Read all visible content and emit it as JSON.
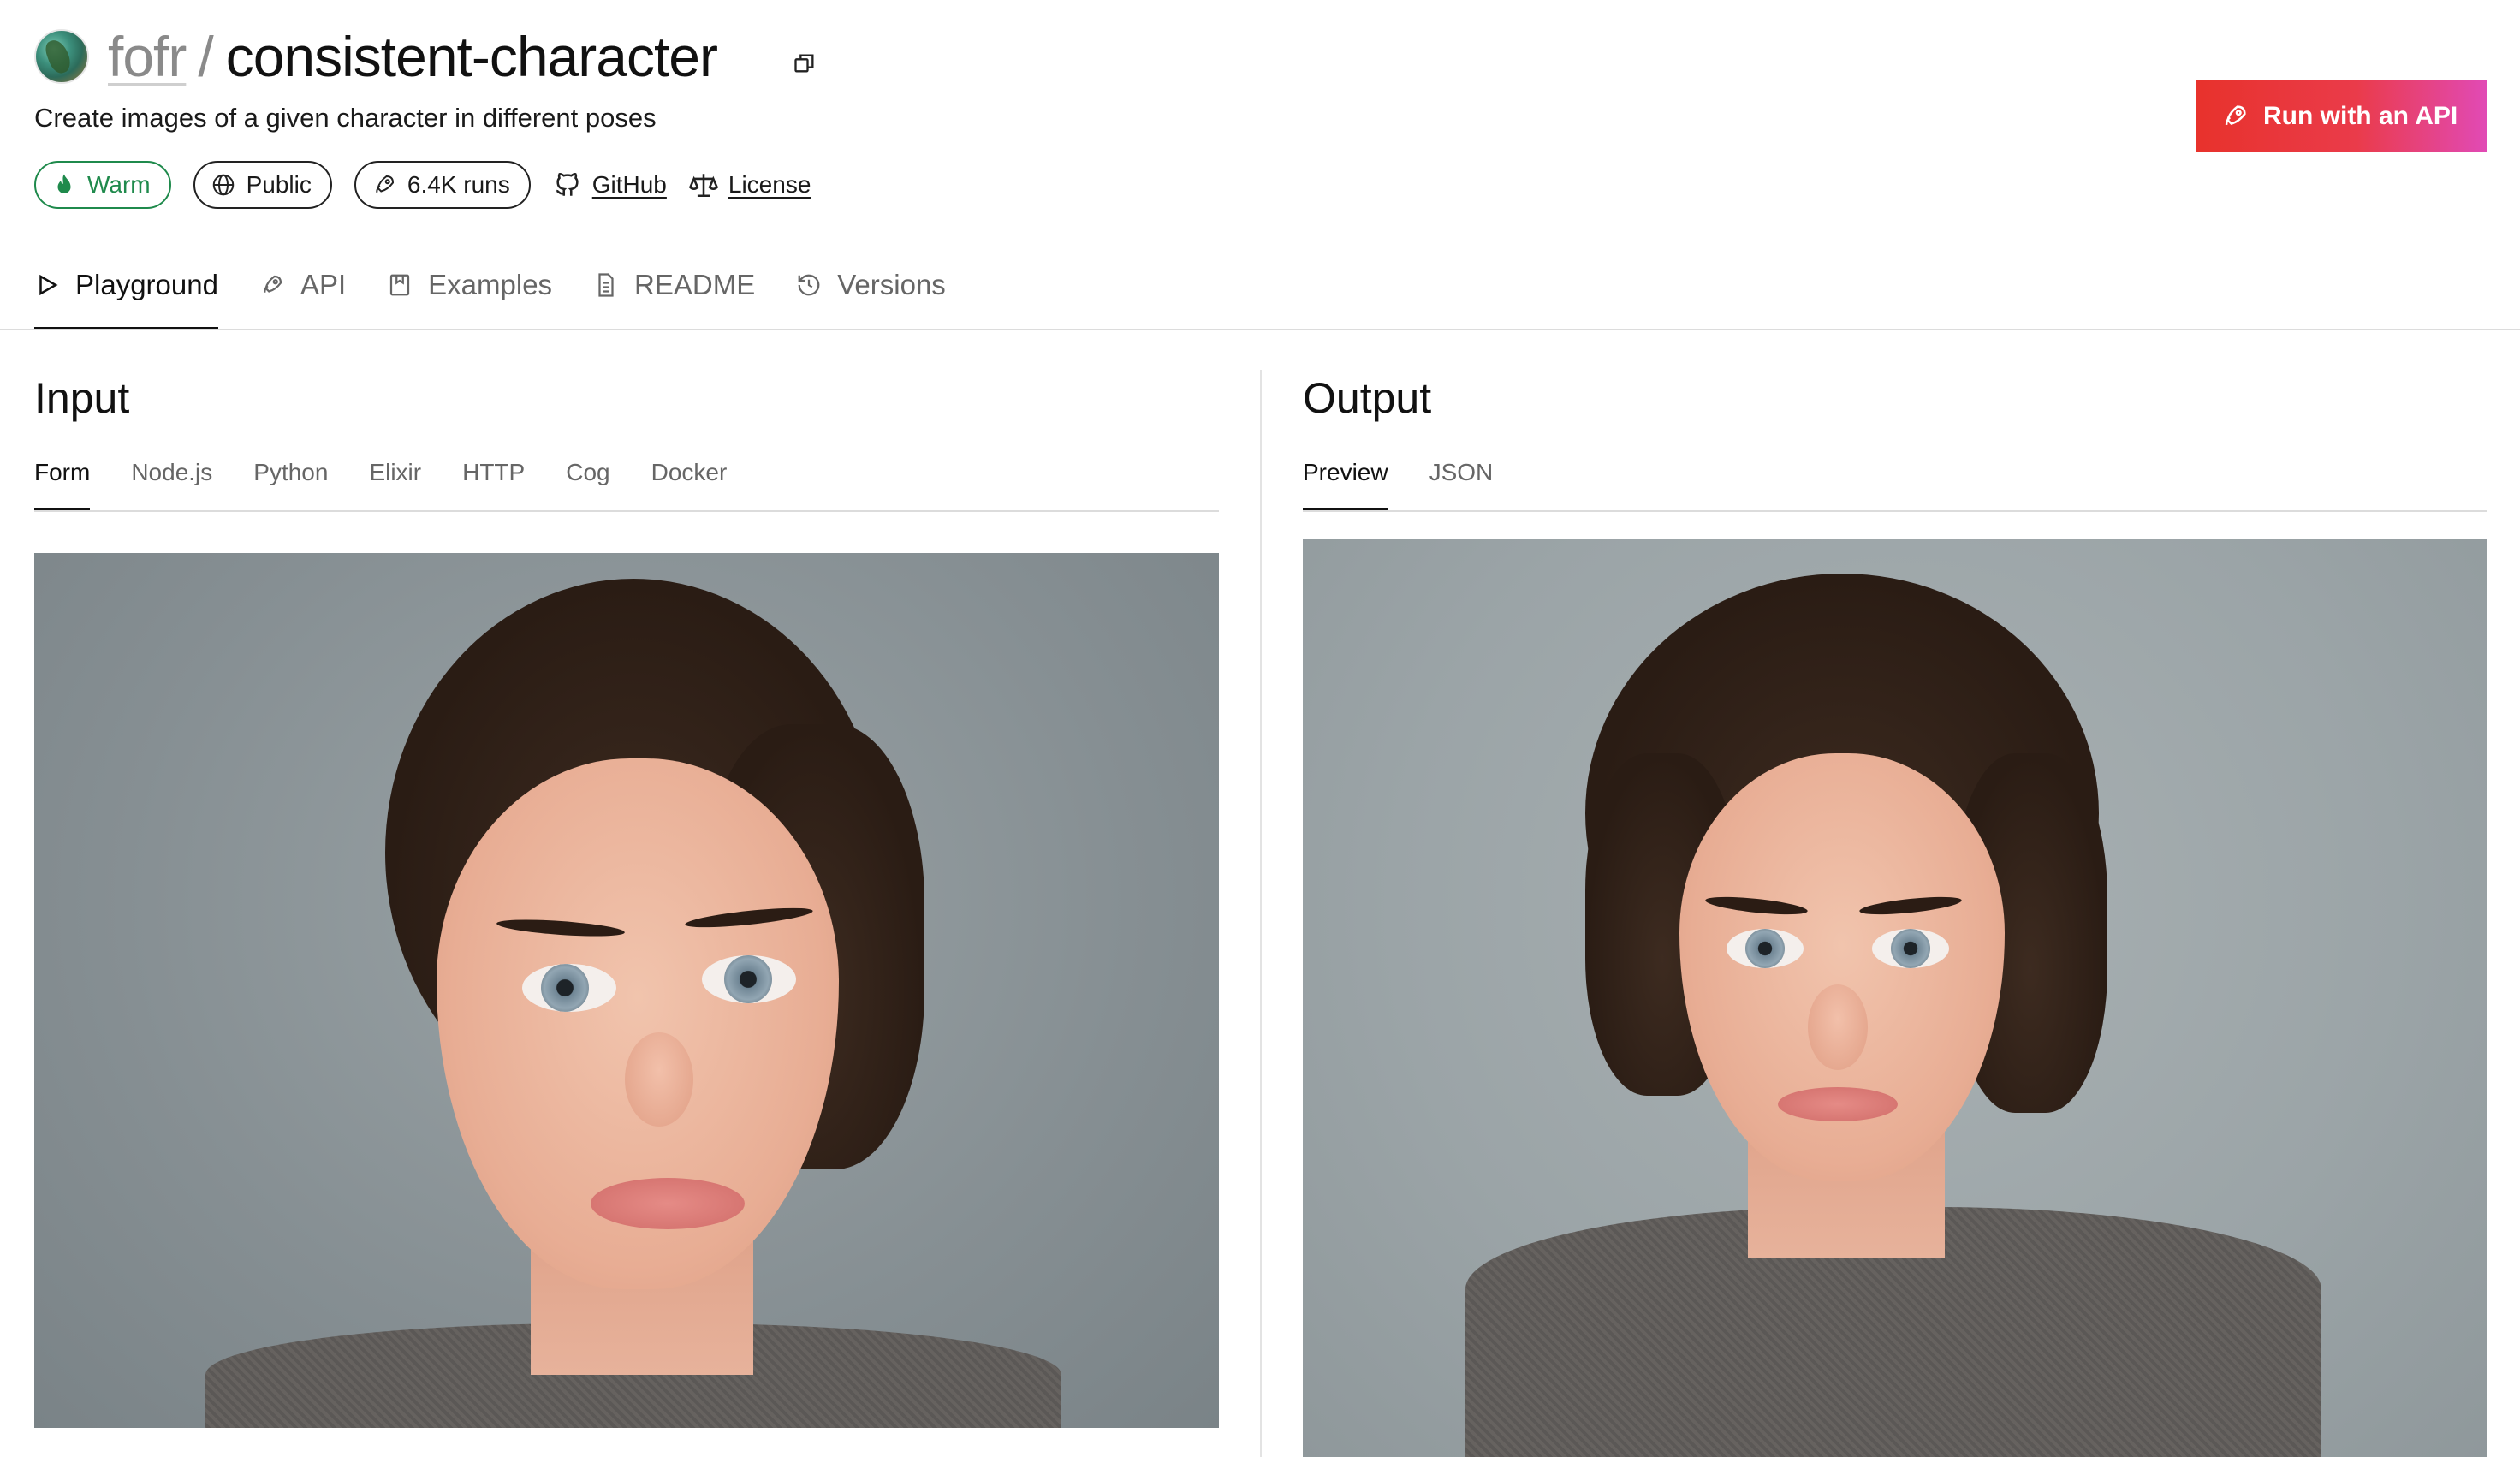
{
  "header": {
    "owner": "fofr",
    "separator": "/",
    "model_name": "consistent-character",
    "description": "Create images of a given character in different poses",
    "run_api_label": "Run with an API"
  },
  "badges": {
    "warm": "Warm",
    "public": "Public",
    "runs": "6.4K runs",
    "github": "GitHub",
    "license": "License"
  },
  "main_tabs": [
    {
      "label": "Playground",
      "icon": "play-icon",
      "active": true
    },
    {
      "label": "API",
      "icon": "rocket-icon"
    },
    {
      "label": "Examples",
      "icon": "bookmark-icon"
    },
    {
      "label": "README",
      "icon": "document-icon"
    },
    {
      "label": "Versions",
      "icon": "history-icon"
    }
  ],
  "input": {
    "title": "Input",
    "tabs": [
      "Form",
      "Node.js",
      "Python",
      "Elixir",
      "HTTP",
      "Cog",
      "Docker"
    ]
  },
  "output": {
    "title": "Output",
    "tabs": [
      "Preview",
      "JSON"
    ]
  },
  "colors": {
    "warm_green": "#1f8a4c",
    "api_gradient_start": "#e8322c",
    "api_gradient_end": "#e14ab6"
  }
}
